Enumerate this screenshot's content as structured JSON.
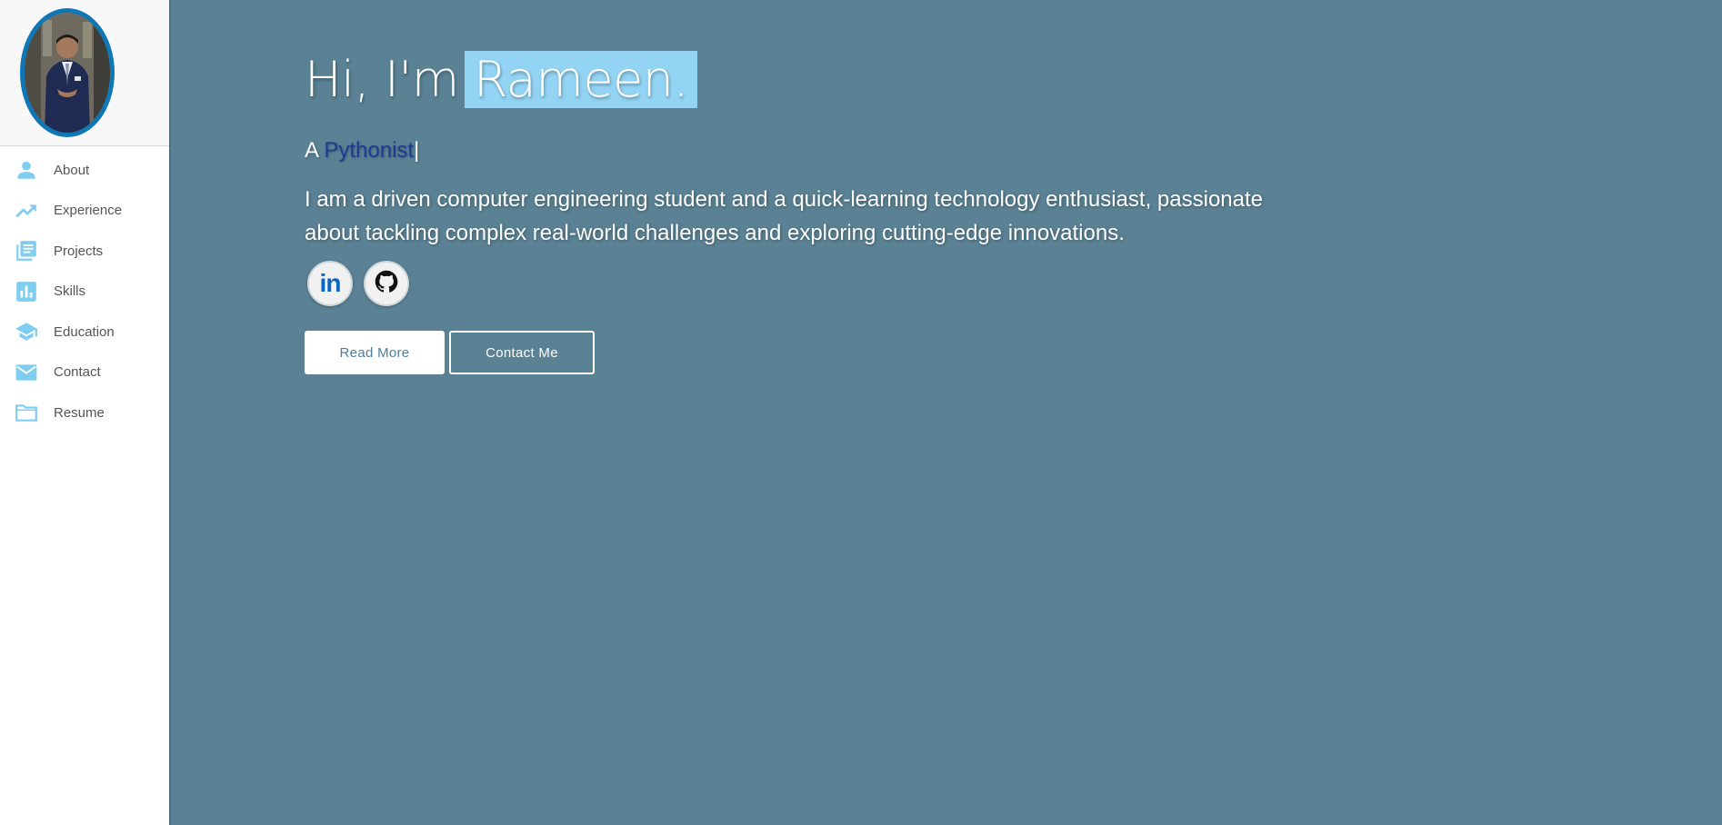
{
  "colors": {
    "background": "#5a8294",
    "sidebar": "#ffffff",
    "accent": "#93d3f3",
    "avatar_ring": "#0f77b6",
    "role_word": "#1d3a95",
    "linkedin": "#0a66c2"
  },
  "sidebar": {
    "avatar_alt": "profile photo",
    "items": [
      {
        "label": "About",
        "icon": "person-icon"
      },
      {
        "label": "Experience",
        "icon": "trending-up-icon"
      },
      {
        "label": "Projects",
        "icon": "library-books-icon"
      },
      {
        "label": "Skills",
        "icon": "bar-chart-icon"
      },
      {
        "label": "Education",
        "icon": "school-icon"
      },
      {
        "label": "Contact",
        "icon": "mail-icon"
      },
      {
        "label": "Resume",
        "icon": "folder-icon"
      }
    ]
  },
  "hero": {
    "greeting_prefix": "Hi, I'm",
    "name": "Rameen.",
    "role_prefix": "A",
    "role_word": "Pythonist",
    "cursor": "|",
    "bio": "I am a driven computer engineering student and a quick-learning technology enthusiast, passionate about tackling complex real-world challenges and exploring cutting-edge innovations.",
    "socials": [
      {
        "name": "LinkedIn",
        "icon": "linkedin-icon",
        "text": "in"
      },
      {
        "name": "GitHub",
        "icon": "github-icon"
      }
    ],
    "buttons": {
      "read_more": "Read More",
      "contact_me": "Contact Me"
    }
  }
}
